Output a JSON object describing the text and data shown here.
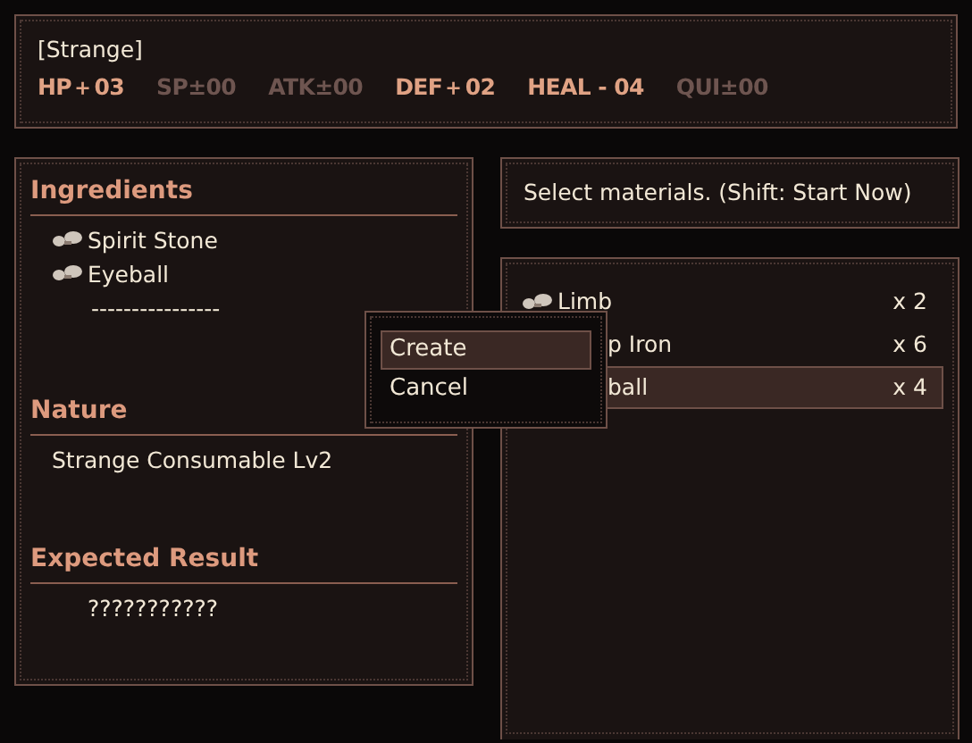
{
  "info": {
    "title": "[Strange]",
    "stats": [
      {
        "text": "HP＋03",
        "changed": true
      },
      {
        "text": "SP±00",
        "changed": false
      },
      {
        "text": "ATK±00",
        "changed": false
      },
      {
        "text": "DEF＋02",
        "changed": true
      },
      {
        "text": "HEAL - 04",
        "changed": true
      },
      {
        "text": "QUI±00",
        "changed": false
      }
    ]
  },
  "ingredients": {
    "heading": "Ingredients",
    "items": [
      {
        "kind": "item",
        "name": "Spirit Stone"
      },
      {
        "kind": "item",
        "name": "Eyeball"
      },
      {
        "kind": "empty",
        "name": "----------------"
      }
    ]
  },
  "nature": {
    "heading": "Nature",
    "text": "Strange Consumable Lv2"
  },
  "expected_result": {
    "heading": "Expected Result",
    "text": "???????????"
  },
  "help": "Select materials. (Shift: Start Now)",
  "materials": [
    {
      "name": "Limb",
      "count": "x 2",
      "selected": false,
      "covered": false
    },
    {
      "name": "p Iron",
      "count": "x 6",
      "selected": false,
      "covered": true
    },
    {
      "name": "ball",
      "count": "x 4",
      "selected": true,
      "covered": true
    }
  ],
  "menu": [
    {
      "label": "Create",
      "selected": true
    },
    {
      "label": "Cancel",
      "selected": false
    }
  ]
}
